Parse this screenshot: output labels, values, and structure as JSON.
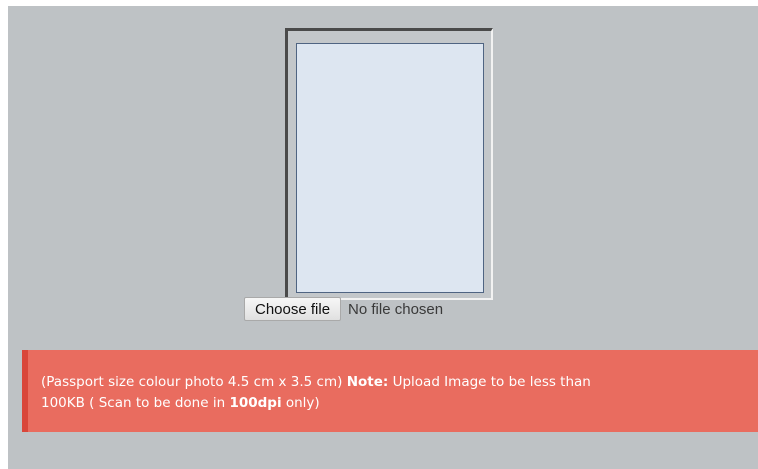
{
  "upload": {
    "choose_button_label": "Choose file",
    "file_status": "No file chosen"
  },
  "note": {
    "line1_prefix": "(Passport size colour photo 4.5 cm x 3.5 cm) ",
    "note_label": "Note:",
    "line1_suffix": " Upload Image to be less than",
    "line2_prefix": "100KB ( Scan to be done in ",
    "dpi_value": "100dpi",
    "line2_suffix": " only)"
  },
  "colors": {
    "panel_background": "#bec2c5",
    "photo_placeholder": "#dde6f1",
    "note_background": "#e96c5f",
    "note_border": "#d9463a"
  }
}
